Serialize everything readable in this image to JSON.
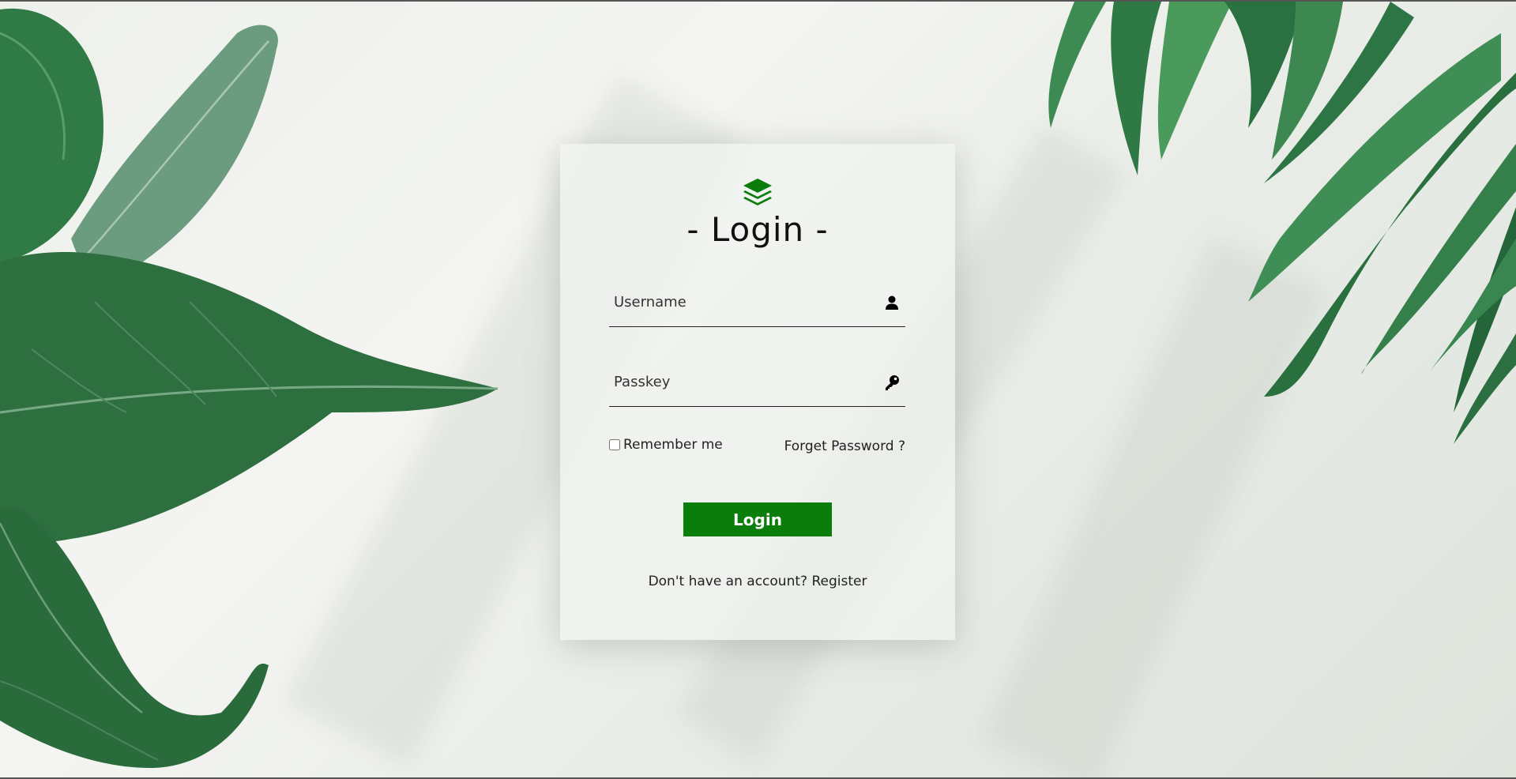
{
  "login_card": {
    "title": "- Login -",
    "logo_icon": "layers-icon",
    "username": {
      "placeholder": "Username",
      "value": "",
      "icon": "user-icon"
    },
    "passkey": {
      "placeholder": "Passkey",
      "value": "",
      "icon": "key-icon"
    },
    "remember_label": "Remember me",
    "remember_checked": false,
    "forgot_label": "Forget Password ?",
    "login_button_label": "Login",
    "register_prompt": "Don't have an account?",
    "register_link": "Register"
  },
  "colors": {
    "accent": "#0a7d0a",
    "leaf_dark": "#1f6b3a",
    "leaf_light": "#4d9a5e",
    "wall": "#eef0ec"
  }
}
